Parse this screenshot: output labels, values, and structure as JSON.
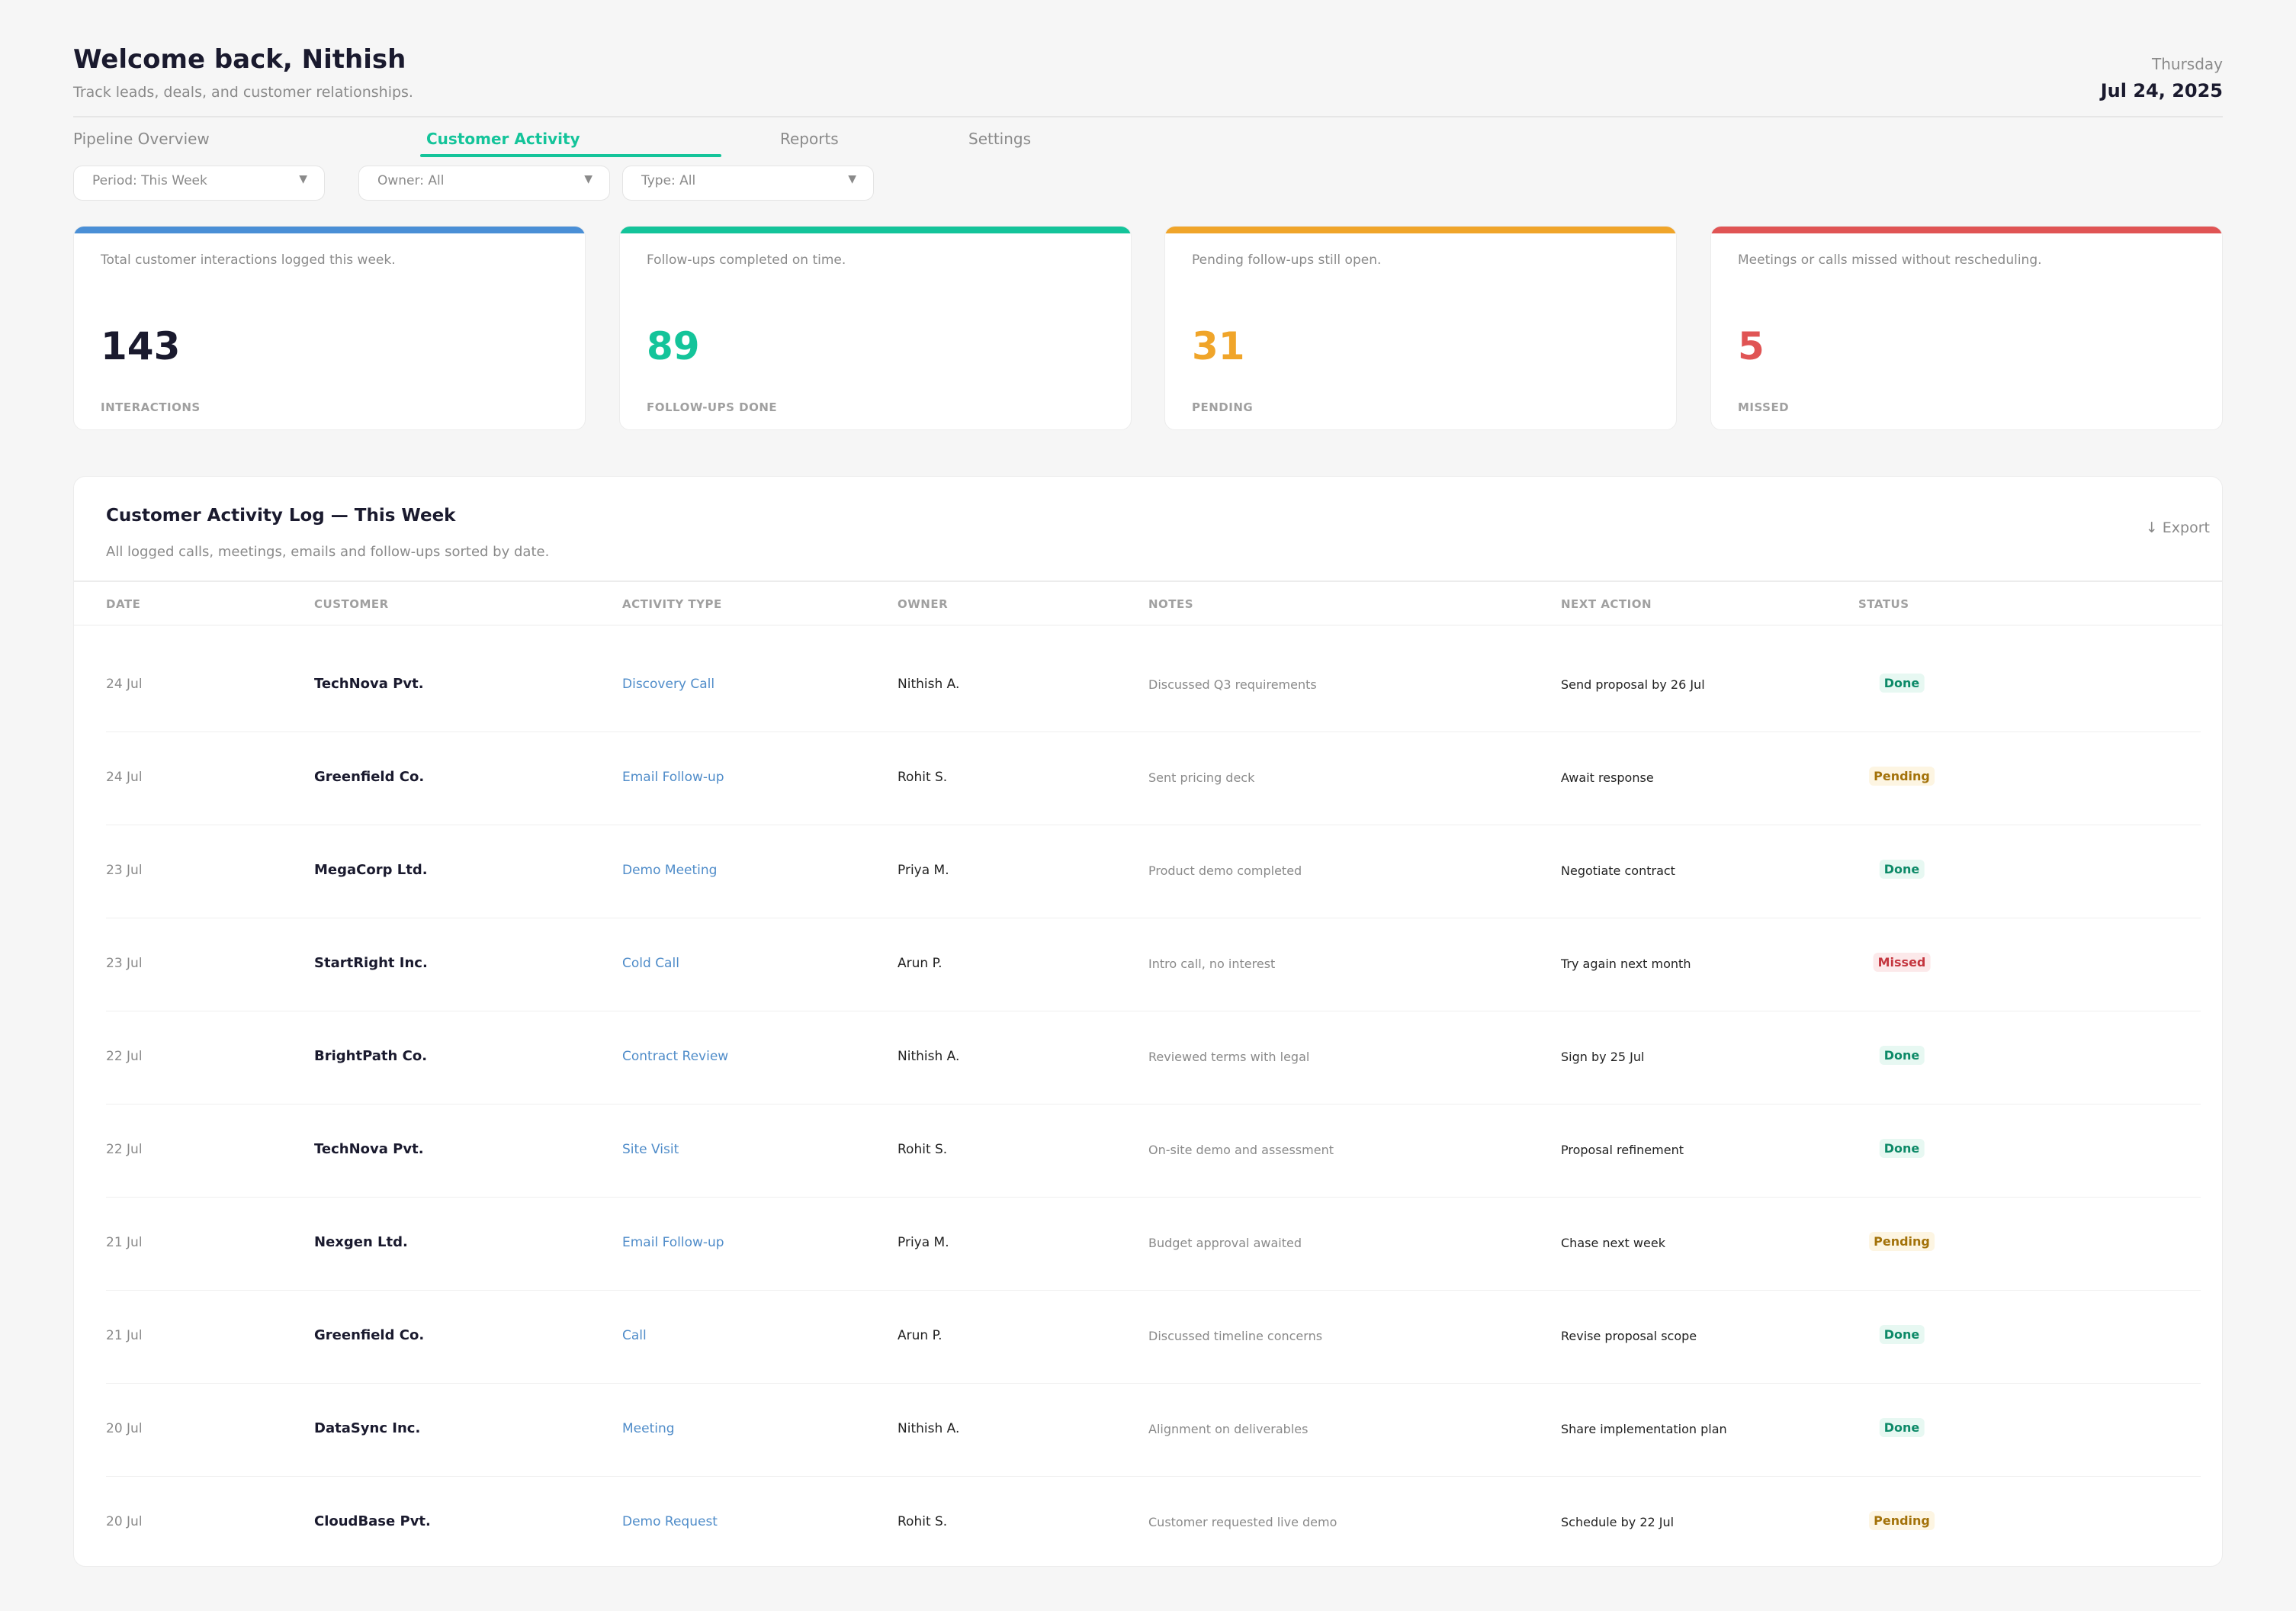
{
  "header": {
    "welcome": "Welcome back, Nithish",
    "subtitle": "Track leads, deals, and customer relationships.",
    "day": "Thursday",
    "date": "Jul 24, 2025"
  },
  "tabs": [
    {
      "label": "Pipeline Overview",
      "active": false
    },
    {
      "label": "Customer Activity",
      "active": true
    },
    {
      "label": "Reports",
      "active": false
    },
    {
      "label": "Settings",
      "active": false
    }
  ],
  "filters": [
    {
      "label": "Period: This Week",
      "icon": "chevron-down-icon"
    },
    {
      "label": "Owner: All",
      "icon": "chevron-down-icon"
    },
    {
      "label": "Type: All",
      "icon": "chevron-down-icon"
    }
  ],
  "kpis": [
    {
      "description": "Total customer interactions logged this week.",
      "value": "143",
      "label": "INTERACTIONS",
      "accent": "#4a8fd6",
      "value_color": "#1a1a2e"
    },
    {
      "description": "Follow-ups completed on time.",
      "value": "89",
      "label": "FOLLOW-UPS DONE",
      "accent": "#14c49a",
      "value_color": "#14c49a"
    },
    {
      "description": "Pending follow-ups still open.",
      "value": "31",
      "label": "PENDING",
      "accent": "#f0a52a",
      "value_color": "#f0a52a"
    },
    {
      "description": "Meetings or calls missed without rescheduling.",
      "value": "5",
      "label": "MISSED",
      "accent": "#e05454",
      "value_color": "#e05454"
    }
  ],
  "log": {
    "title": "Customer Activity Log — This Week",
    "subtitle": "All logged calls, meetings, emails and follow-ups sorted by date.",
    "export_label": "↓ Export",
    "columns": [
      "DATE",
      "CUSTOMER",
      "ACTIVITY TYPE",
      "OWNER",
      "NOTES",
      "NEXT ACTION",
      "STATUS"
    ],
    "rows": [
      {
        "date": "24 Jul",
        "customer": "TechNova Pvt.",
        "type": "Discovery Call",
        "owner": "Nithish A.",
        "notes": "Discussed Q3 requirements",
        "next": "Send proposal by 26 Jul",
        "status": "Done"
      },
      {
        "date": "24 Jul",
        "customer": "Greenfield Co.",
        "type": "Email Follow-up",
        "owner": "Rohit S.",
        "notes": "Sent pricing deck",
        "next": "Await response",
        "status": "Pending"
      },
      {
        "date": "23 Jul",
        "customer": "MegaCorp Ltd.",
        "type": "Demo Meeting",
        "owner": "Priya M.",
        "notes": "Product demo completed",
        "next": "Negotiate contract",
        "status": "Done"
      },
      {
        "date": "23 Jul",
        "customer": "StartRight Inc.",
        "type": "Cold Call",
        "owner": "Arun P.",
        "notes": "Intro call, no interest",
        "next": "Try again next month",
        "status": "Missed"
      },
      {
        "date": "22 Jul",
        "customer": "BrightPath Co.",
        "type": "Contract Review",
        "owner": "Nithish A.",
        "notes": "Reviewed terms with legal",
        "next": "Sign by 25 Jul",
        "status": "Done"
      },
      {
        "date": "22 Jul",
        "customer": "TechNova Pvt.",
        "type": "Site Visit",
        "owner": "Rohit S.",
        "notes": "On-site demo and assessment",
        "next": "Proposal refinement",
        "status": "Done"
      },
      {
        "date": "21 Jul",
        "customer": "Nexgen Ltd.",
        "type": "Email Follow-up",
        "owner": "Priya M.",
        "notes": "Budget approval awaited",
        "next": "Chase next week",
        "status": "Pending"
      },
      {
        "date": "21 Jul",
        "customer": "Greenfield Co.",
        "type": "Call",
        "owner": "Arun P.",
        "notes": "Discussed timeline concerns",
        "next": "Revise proposal scope",
        "status": "Done"
      },
      {
        "date": "20 Jul",
        "customer": "DataSync Inc.",
        "type": "Meeting",
        "owner": "Nithish A.",
        "notes": "Alignment on deliverables",
        "next": "Share implementation plan",
        "status": "Done"
      },
      {
        "date": "20 Jul",
        "customer": "CloudBase Pvt.",
        "type": "Demo Request",
        "owner": "Rohit S.",
        "notes": "Customer requested live demo",
        "next": "Schedule by 22 Jul",
        "status": "Pending"
      }
    ]
  }
}
